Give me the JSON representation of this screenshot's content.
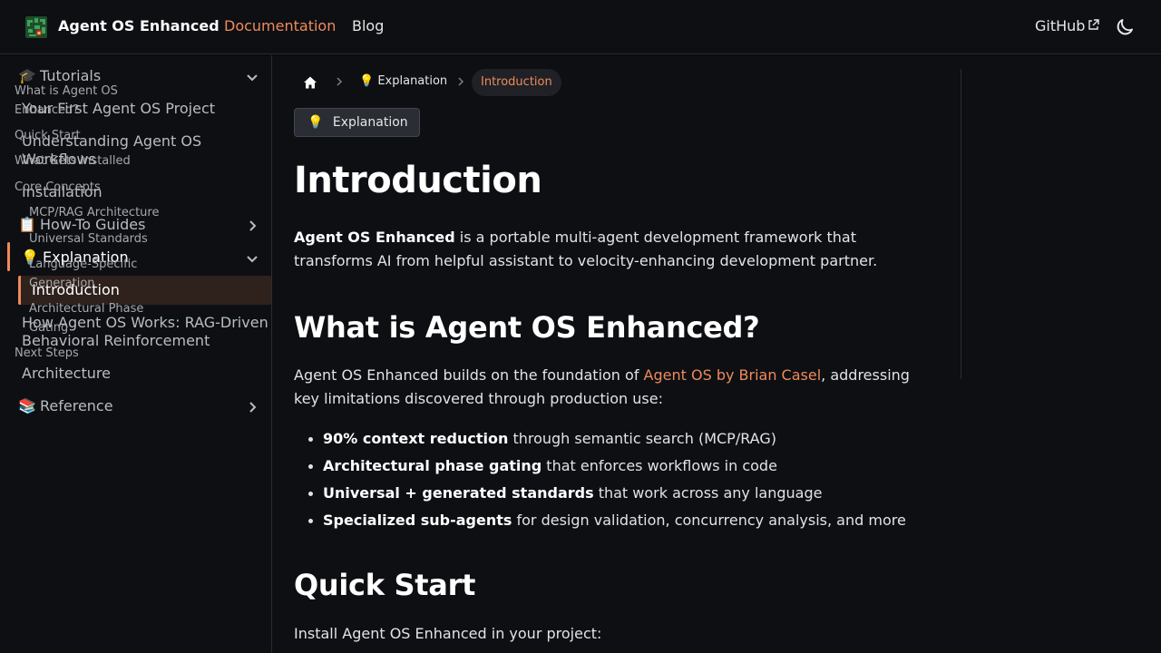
{
  "navbar": {
    "brand": "Agent OS Enhanced",
    "links": {
      "docs": "Documentation",
      "blog": "Blog",
      "github": "GitHub"
    },
    "accent_color": "#ef8a5b"
  },
  "sidebar": {
    "tutorials": {
      "emoji": "🎓",
      "label": "Tutorials"
    },
    "tut_items": [
      "Your First Agent OS Project",
      "Understanding Agent OS Workflows",
      "Installation"
    ],
    "howto": {
      "emoji": "📋",
      "label": "How-To Guides"
    },
    "explanation": {
      "emoji": "💡",
      "label": "Explanation"
    },
    "exp_items": [
      "Introduction",
      "How Agent OS Works: RAG-Driven Behavioral Reinforcement",
      "Architecture"
    ],
    "reference": {
      "emoji": "📚",
      "label": "Reference"
    }
  },
  "breadcrumb": {
    "section": "Explanation",
    "section_emoji": "💡",
    "current": "Introduction"
  },
  "tag": {
    "emoji": "💡",
    "label": "Explanation"
  },
  "article": {
    "title": "Introduction",
    "intro_bold": "Agent OS Enhanced",
    "intro_rest": " is a portable multi-agent development framework that transforms AI from helpful assistant to velocity-enhancing development partner.",
    "h2_what": "What is Agent OS Enhanced?",
    "what_pre": "Agent OS Enhanced builds on the foundation of ",
    "what_link": "Agent OS by Brian Casel",
    "what_post": ", addressing key limitations discovered through production use:",
    "bullets": [
      {
        "bold": "90% context reduction",
        "rest": " through semantic search (MCP/RAG)"
      },
      {
        "bold": "Architectural phase gating",
        "rest": " that enforces workflows in code"
      },
      {
        "bold": "Universal + generated standards",
        "rest": " that work across any language"
      },
      {
        "bold": "Specialized sub-agents",
        "rest": " for design validation, concurrency analysis, and more"
      }
    ],
    "h2_quick": "Quick Start",
    "quick_text": "Install Agent OS Enhanced in your project:"
  },
  "toc": [
    "What is Agent OS Enhanced?",
    "Quick Start",
    "What Gets Installed",
    "Core Concepts",
    "MCP/RAG Architecture",
    "Universal Standards",
    "Language-Specific Generation",
    "Architectural Phase Gating",
    "Next Steps"
  ]
}
